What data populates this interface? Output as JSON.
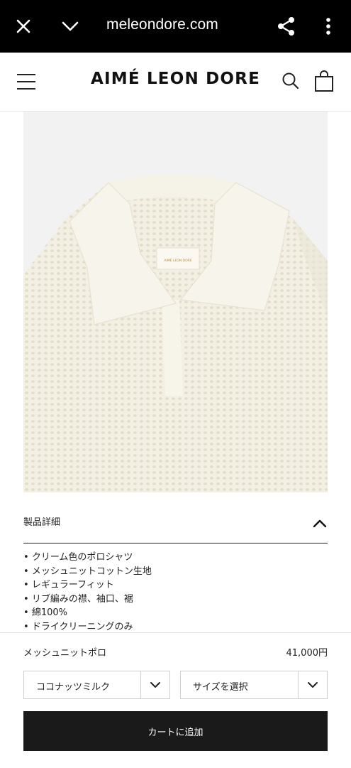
{
  "browser": {
    "url": "meleondore.com"
  },
  "header": {
    "brand": "AIMÉ LEON DORE"
  },
  "product_image": {
    "tag_text": "AIMÉ LEON DORE",
    "description": "Cream mesh knit polo shirt"
  },
  "details": {
    "title": "製品詳細",
    "items": [
      "クリーム色のポロシャツ",
      "メッシュニットコットン生地",
      "レギュラーフィット",
      "リブ編みの襟、袖口、裾",
      "綿100%",
      "ドライクリーニングのみ"
    ]
  },
  "purchase": {
    "name": "メッシュニットポロ",
    "price": "41,000円",
    "color_value": "ココナッツミルク",
    "size_value": "サイズを選択",
    "add_to_cart": "カートに追加"
  }
}
